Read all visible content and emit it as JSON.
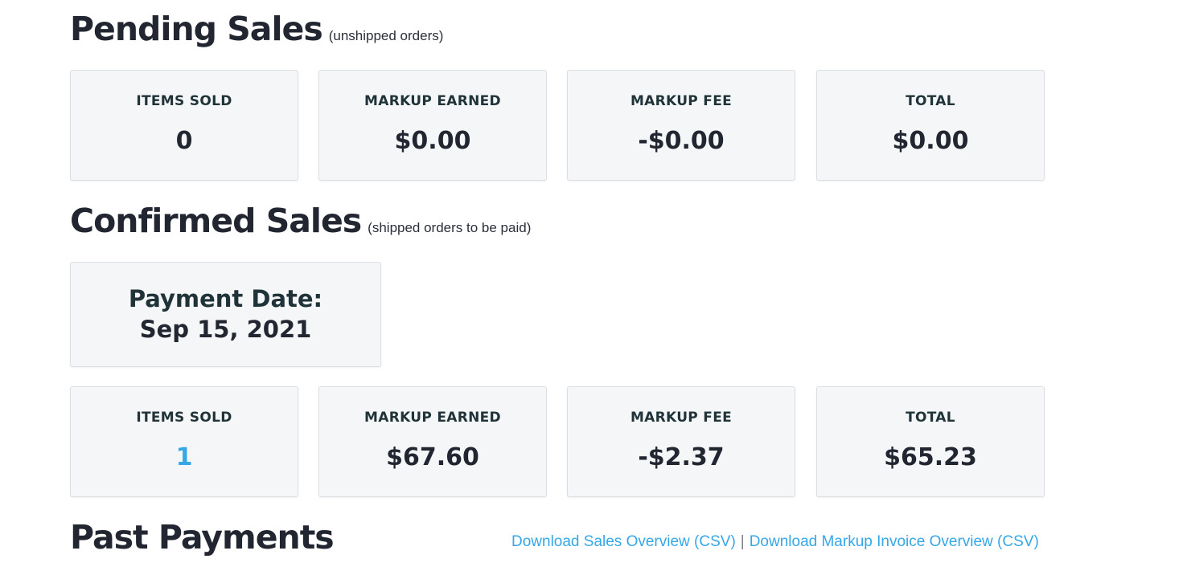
{
  "pending": {
    "title": "Pending Sales",
    "subtitle": "(unshipped orders)",
    "stats": [
      {
        "label": "ITEMS SOLD",
        "value": "0"
      },
      {
        "label": "MARKUP EARNED",
        "value": "$0.00"
      },
      {
        "label": "MARKUP FEE",
        "value": "-$0.00"
      },
      {
        "label": "TOTAL",
        "value": "$0.00"
      }
    ]
  },
  "confirmed": {
    "title": "Confirmed Sales",
    "subtitle": "(shipped orders to be paid)",
    "payment_date_label": "Payment Date:",
    "payment_date_value": "Sep 15, 2021",
    "stats": [
      {
        "label": "ITEMS SOLD",
        "value": "1"
      },
      {
        "label": "MARKUP EARNED",
        "value": "$67.60"
      },
      {
        "label": "MARKUP FEE",
        "value": "-$2.37"
      },
      {
        "label": "TOTAL",
        "value": "$65.23"
      }
    ]
  },
  "past": {
    "title": "Past Payments",
    "download_sales_label": "Download Sales Overview (CSV)",
    "separator": "|",
    "download_invoice_label": "Download Markup Invoice Overview (CSV)"
  },
  "colors": {
    "link": "#36a7e6",
    "text": "#222631",
    "card_bg": "#f5f6f8"
  }
}
